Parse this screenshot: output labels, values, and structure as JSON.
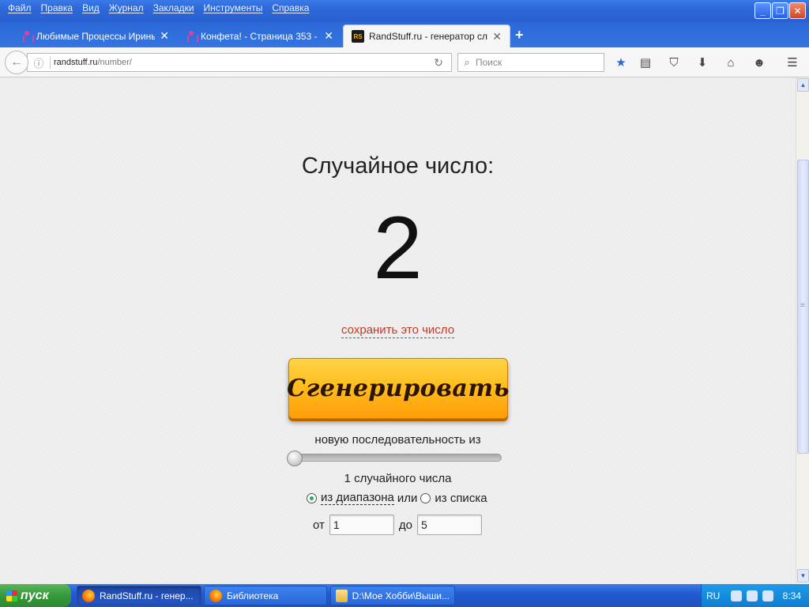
{
  "menu": [
    "Файл",
    "Правка",
    "Вид",
    "Журнал",
    "Закладки",
    "Инструменты",
    "Справка"
  ],
  "tabs": [
    {
      "title": "Любимые Процессы Ирины i...",
      "icon": "person-icon"
    },
    {
      "title": "Конфета! - Страница 353 - ...",
      "icon": "person-icon"
    },
    {
      "title": "RandStuff.ru - генератор сл...",
      "icon": "randstuff-icon",
      "icon_text": "RS"
    }
  ],
  "navbar": {
    "url_host": "randstuff.ru",
    "url_path": "/number/",
    "search_placeholder": "Поиск"
  },
  "page": {
    "heading": "Случайное число:",
    "number": "2",
    "save_link": "сохранить это число",
    "generate_button": "Сгенерировать",
    "sequence_label": "новую последовательность из",
    "slider_value": 1,
    "count_label": "1 случайного числа",
    "mode_range": "из диапазона",
    "mode_or": "или",
    "mode_list": "из списка",
    "from_label": "от",
    "from_value": "1",
    "to_label": "до",
    "to_value": "5"
  },
  "taskbar": {
    "start_label": "пуск",
    "tasks": [
      {
        "title": "RandStuff.ru - генер...",
        "icon": "firefox-icon"
      },
      {
        "title": "Библиотека",
        "icon": "firefox-icon"
      },
      {
        "title": "D:\\Мое Хобби\\Выши...",
        "icon": "folder-icon"
      }
    ],
    "lang": "RU",
    "clock": "8:34"
  },
  "colors": {
    "accent_link": "#c0392b",
    "button_orange": "#ffbe1d",
    "xp_blue": "#2a5fd0"
  }
}
